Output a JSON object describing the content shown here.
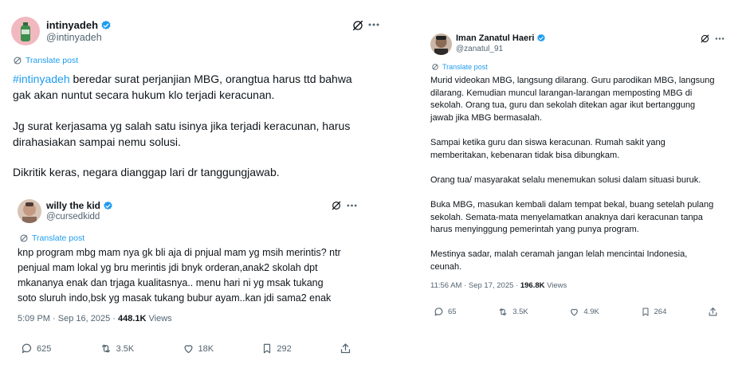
{
  "left": {
    "author_name": "intinyadeh",
    "author_handle": "@intinyadeh",
    "translate_label": "Translate post",
    "hashtag": "#intinyadeh",
    "para1_rest": " beredar surat perjanjian MBG, orangtua harus ttd bahwa\ngak akan nuntut secara hukum klo terjadi keracunan.",
    "para2": "Jg surat kerjasama yg salah satu isinya jika terjadi keracunan, harus\ndirahasiakan sampai nemu solusi.",
    "para3": "Dikritik keras, negara dianggap lari dr tanggungjawab.",
    "quote": {
      "author_name": "willy the kid",
      "author_handle": "@cursedkidd",
      "translate_label": "Translate post",
      "text": "knp program mbg mam nya gk bli aja di pnjual mam yg msih merintis? ntr\npenjual mam lokal yg bru merintis jdi bnyk orderan,anak2 skolah dpt\nmkananya enak dan trjaga kualitasnya.. menu hari ni yg msak tukang\nsoto sluruh indo,bsk yg masak tukang bubur ayam..kan jdi sama2 enak",
      "time": "5:09 PM · Sep 16, 2025 · ",
      "views_count": "448.1K",
      "views_label": " Views",
      "replies": "625",
      "reposts": "3.5K",
      "likes": "18K",
      "bookmarks": "292"
    }
  },
  "right": {
    "author_name": "Iman Zanatul Haeri",
    "author_handle": "@zanatul_91",
    "translate_label": "Translate post",
    "text": "Murid videokan MBG, langsung dilarang. Guru parodikan MBG, langsung\ndilarang. Kemudian muncul larangan-larangan memposting MBG di\nsekolah. Orang tua, guru dan sekolah ditekan agar ikut bertanggung\njawab jika MBG bermasalah.\n\nSampai ketika guru dan siswa keracunan. Rumah sakit yang\nmemberitakan, kebenaran tidak bisa dibungkam.\n\nOrang tua/ masyarakat selalu menemukan solusi dalam situasi buruk.\n\nBuka MBG, masukan kembali dalam tempat bekal, buang setelah pulang\nsekolah. Semata-mata menyelamatkan anaknya dari keracunan tanpa\nharus menyinggung pemerintah yang punya program.\n\nMestinya sadar, malah ceramah jangan lelah mencintai Indonesia,\nceunah.",
    "time": "11:56 AM · Sep 17, 2025 · ",
    "views_count": "196.8K",
    "views_label": " Views",
    "replies": "65",
    "reposts": "3.5K",
    "likes": "4.9K",
    "bookmarks": "264"
  },
  "colors": {
    "accent": "#1d9bf0",
    "muted": "#536471",
    "text": "#0f1419"
  },
  "icons": [
    "verified-badge-icon",
    "grok-icon",
    "more-icon",
    "translate-globe-icon",
    "reply-icon",
    "repost-icon",
    "like-icon",
    "bookmark-icon",
    "share-icon"
  ]
}
